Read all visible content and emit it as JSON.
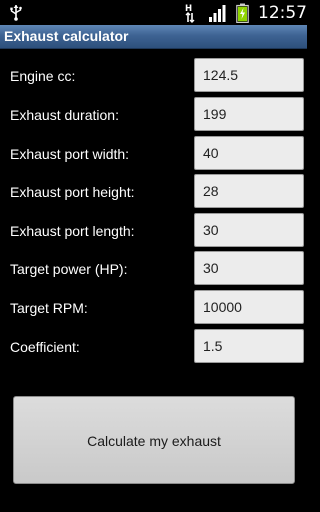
{
  "status_bar": {
    "time": "12:57",
    "network_label": "H",
    "icons": [
      "usb-icon",
      "hsdpa-icon",
      "signal-icon",
      "battery-icon"
    ]
  },
  "app": {
    "title": "Exhaust calculator"
  },
  "form": {
    "fields": [
      {
        "label": "Engine cc:",
        "value": "124.5"
      },
      {
        "label": "Exhaust duration:",
        "value": "199"
      },
      {
        "label": "Exhaust port width:",
        "value": "40"
      },
      {
        "label": "Exhaust port height:",
        "value": "28"
      },
      {
        "label": "Exhaust port length:",
        "value": "30"
      },
      {
        "label": "Target power (HP):",
        "value": "30"
      },
      {
        "label": "Target RPM:",
        "value": "10000"
      },
      {
        "label": "Coefficient:",
        "value": "1.5"
      }
    ]
  },
  "actions": {
    "calculate_label": "Calculate my exhaust"
  },
  "colors": {
    "background": "#000000",
    "title_bar": "#3e6393",
    "field_background": "#ececec",
    "button_background": "#d3d3d3",
    "battery_fill": "#8fd400"
  }
}
